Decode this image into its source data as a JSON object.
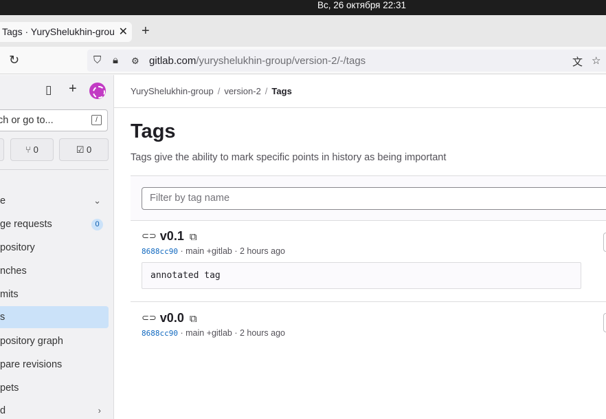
{
  "system_bar": {
    "datetime": "Вс, 26 октября  22:31"
  },
  "browser": {
    "tab_title": "Tags · YuryShelukhin-grou",
    "url_host": "gitlab.com",
    "url_path": "/yuryshelukhin-group/version-2/-/tags"
  },
  "sidebar": {
    "search_placeholder": "ch or go to...",
    "search_shortcut": "/",
    "merge_count": "0",
    "todo_count": "0",
    "section_label": "e",
    "items": [
      {
        "label": "ge requests",
        "badge": "0"
      },
      {
        "label": "pository"
      },
      {
        "label": "nches"
      },
      {
        "label": "mits"
      },
      {
        "label": "s"
      },
      {
        "label": "pository graph"
      },
      {
        "label": "pare revisions"
      },
      {
        "label": "pets"
      },
      {
        "label": "d"
      }
    ]
  },
  "breadcrumb": {
    "group": "YuryShelukhin-group",
    "project": "version-2",
    "current": "Tags"
  },
  "page": {
    "title": "Tags",
    "description": "Tags give the ability to mark specific points in history as being important",
    "filter_placeholder": "Filter by tag name"
  },
  "tags": [
    {
      "name": "v0.1",
      "sha": "8688cc90",
      "meta": "· main +gitlab · 2 hours ago",
      "message": "annotated tag"
    },
    {
      "name": "v0.0",
      "sha": "8688cc90",
      "meta": "· main +gitlab · 2 hours ago"
    }
  ]
}
